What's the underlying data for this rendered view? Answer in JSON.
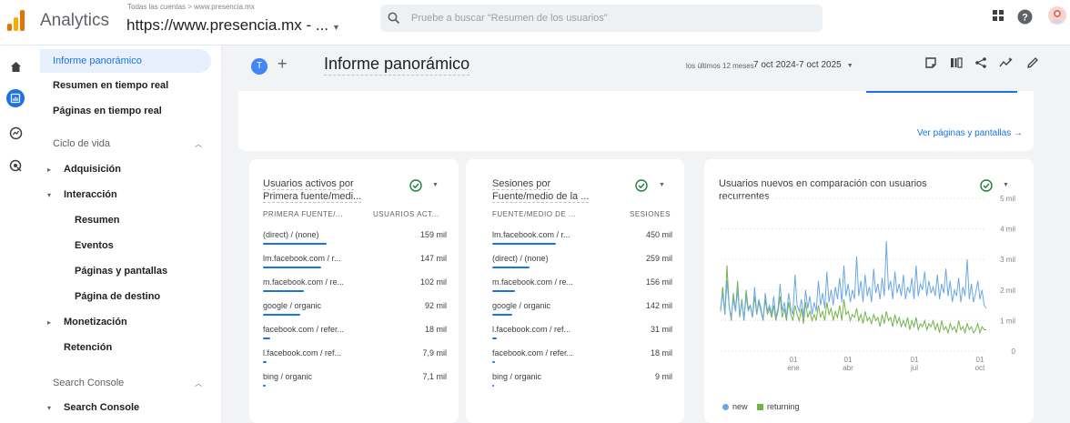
{
  "header": {
    "app_title": "Analytics",
    "breadcrumb": "Todas las cuentas > www.presencia.mx",
    "property": "https://www.presencia.mx - ...",
    "search_placeholder": "Pruebe a buscar \"Resumen de los usuarios\""
  },
  "rail": {
    "icons": [
      "home-icon",
      "reports-icon",
      "explore-icon",
      "advertising-icon"
    ]
  },
  "sidebar": {
    "items": [
      {
        "label": "Informe panorámico",
        "type": "active"
      },
      {
        "label": "Resumen en tiempo real",
        "type": "top"
      },
      {
        "label": "Páginas en tiempo real",
        "type": "top"
      },
      {
        "label": "Ciclo de vida",
        "type": "section"
      },
      {
        "label": "Adquisición",
        "type": "group"
      },
      {
        "label": "Interacción",
        "type": "group"
      },
      {
        "label": "Resumen",
        "type": "sub"
      },
      {
        "label": "Eventos",
        "type": "sub"
      },
      {
        "label": "Páginas y pantallas",
        "type": "sub"
      },
      {
        "label": "Página de destino",
        "type": "sub"
      },
      {
        "label": "Monetización",
        "type": "group"
      },
      {
        "label": "Retención",
        "type": "top"
      },
      {
        "label": "Search Console",
        "type": "section"
      },
      {
        "label": "Search Console",
        "type": "group"
      }
    ]
  },
  "report": {
    "avatar_letter": "T",
    "title": "Informe panorámico",
    "range_label": "los últimos 12 meses",
    "range": "7 oct 2024-7 oct 2025",
    "view_link": "Ver páginas y pantallas →"
  },
  "card1": {
    "title_line1": "Usuarios activos por",
    "title_line2": "Primera fuente/medi...",
    "col1": "PRIMERA FUENTE/...",
    "col2": "USUARIOS ACT...",
    "rows": [
      {
        "label": "(direct) / (none)",
        "value": "159 mil",
        "share": 1.0
      },
      {
        "label": "lm.facebook.com / r...",
        "value": "147 mil",
        "share": 0.92
      },
      {
        "label": "m.facebook.com / re...",
        "value": "102 mil",
        "share": 0.64
      },
      {
        "label": "google / organic",
        "value": "92 mil",
        "share": 0.58
      },
      {
        "label": "facebook.com / refer...",
        "value": "18 mil",
        "share": 0.11
      },
      {
        "label": "l.facebook.com / ref...",
        "value": "7,9 mil",
        "share": 0.05
      },
      {
        "label": "bing / organic",
        "value": "7,1 mil",
        "share": 0.04
      }
    ]
  },
  "card2": {
    "title_line1": "Sesiones por",
    "title_line2": "Fuente/medio de la ...",
    "col1": "FUENTE/MEDIO DE ...",
    "col2": "SESIONES",
    "rows": [
      {
        "label": "lm.facebook.com / r...",
        "value": "450 mil",
        "share": 1.0
      },
      {
        "label": "(direct) / (none)",
        "value": "259 mil",
        "share": 0.58
      },
      {
        "label": "m.facebook.com / re...",
        "value": "156 mil",
        "share": 0.35
      },
      {
        "label": "google / organic",
        "value": "142 mil",
        "share": 0.32
      },
      {
        "label": "l.facebook.com / ref...",
        "value": "31 mil",
        "share": 0.07
      },
      {
        "label": "facebook.com / refer...",
        "value": "18 mil",
        "share": 0.04
      },
      {
        "label": "bing / organic",
        "value": "9 mil",
        "share": 0.02
      }
    ]
  },
  "card3": {
    "title": "Usuarios nuevos en comparación con usuarios recurrentes"
  },
  "colors": {
    "accent": "#1a73e8",
    "new_series": "#6aa7e8",
    "returning_series": "#72b449"
  },
  "chart_data": {
    "type": "line",
    "title": "Usuarios nuevos en comparación con usuarios recurrentes",
    "x_ticks": [
      {
        "day": "01",
        "month": "ene"
      },
      {
        "day": "01",
        "month": "abr"
      },
      {
        "day": "01",
        "month": "jul"
      },
      {
        "day": "01",
        "month": "oct"
      }
    ],
    "y_ticks": [
      "0",
      "1 mil",
      "2 mil",
      "3 mil",
      "4 mil",
      "5 mil"
    ],
    "ylim": [
      0,
      5000
    ],
    "legend_position": "bottom-left",
    "series": [
      {
        "name": "new",
        "color": "#6aa7e8",
        "values": [
          1400,
          1900,
          1200,
          2300,
          1500,
          1100,
          1700,
          1300,
          2000,
          1200,
          1600,
          1000,
          1800,
          1300,
          1500,
          1100,
          2100,
          1200,
          1700,
          1400,
          1000,
          1900,
          1300,
          1500,
          1200,
          1800,
          1100,
          1400,
          2200,
          1300,
          1600,
          1100,
          1900,
          1400,
          1200,
          2500,
          1500,
          1300,
          1700,
          1100,
          2000,
          1400,
          1800,
          1200,
          1600,
          1300,
          2300,
          1500,
          1900,
          1400,
          2600,
          1600,
          2000,
          1500,
          2100,
          1700,
          2400,
          1600,
          2800,
          1800,
          2200,
          1600,
          2000,
          1700,
          3100,
          1800,
          2300,
          1600,
          2500,
          1800,
          2100,
          1600,
          2700,
          1900,
          2200,
          1700,
          2400,
          1800,
          3600,
          2000,
          2300,
          1700,
          2600,
          1900,
          2200,
          1800,
          2500,
          1700,
          2100,
          1900,
          2400,
          1700,
          2800,
          1800,
          2200,
          2000,
          2600,
          1800,
          2300,
          1900,
          2100,
          1800,
          2500,
          1700,
          2200,
          1900,
          2700,
          1800,
          2300,
          1600,
          2000,
          1800,
          2400,
          1600,
          2100,
          1800,
          3000,
          1700,
          2200,
          1600,
          1900,
          2300,
          1700,
          2000,
          1500,
          1400
        ]
      },
      {
        "name": "returning",
        "color": "#72b449",
        "values": [
          1300,
          2100,
          1200,
          2800,
          1500,
          1000,
          1900,
          1300,
          2300,
          1100,
          1700,
          1000,
          2000,
          1400,
          1500,
          1100,
          1800,
          1200,
          1600,
          1300,
          1000,
          1700,
          1200,
          1400,
          1100,
          1500,
          1000,
          1300,
          1800,
          1100,
          1400,
          1000,
          1600,
          1200,
          1000,
          1500,
          1200,
          1000,
          1400,
          900,
          1600,
          1100,
          1300,
          1000,
          1200,
          1000,
          1500,
          1100,
          1300,
          1000,
          1600,
          1200,
          1400,
          1000,
          1300,
          1100,
          1500,
          1000,
          1700,
          1200,
          1300,
          1000,
          1200,
          1100,
          1400,
          1000,
          1200,
          900,
          1300,
          1000,
          1100,
          900,
          1200,
          1000,
          1100,
          800,
          1200,
          900,
          1300,
          1000,
          1100,
          800,
          1200,
          900,
          1100,
          800,
          1000,
          800,
          1100,
          700,
          1000,
          800,
          1100,
          700,
          900,
          800,
          1000,
          700,
          900,
          800,
          1000,
          700,
          900,
          600,
          1000,
          700,
          800,
          600,
          900,
          700,
          800,
          600,
          1000,
          700,
          800,
          600,
          900,
          700,
          800,
          600,
          700,
          900,
          600,
          800,
          700,
          700
        ]
      }
    ]
  }
}
